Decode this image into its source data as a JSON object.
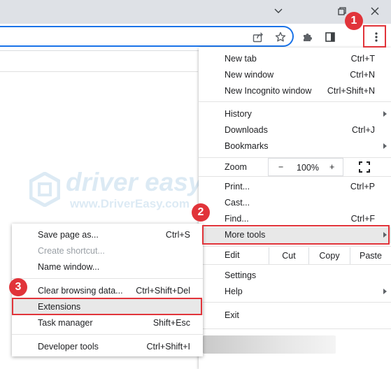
{
  "window": {
    "minimize_icon": "chevron-down-icon",
    "restore_icon": "restore-icon",
    "close_icon": "close-icon"
  },
  "toolbar": {
    "share_icon": "share-icon",
    "bookmark_icon": "star-icon",
    "extensions_icon": "puzzle-icon",
    "side_panel_icon": "side-panel-icon",
    "menu_icon": "kebab-menu-icon"
  },
  "watermark": {
    "name": "driver easy",
    "url": "www.DriverEasy.com"
  },
  "menu": {
    "new_tab": {
      "label": "New tab",
      "shortcut": "Ctrl+T"
    },
    "new_window": {
      "label": "New window",
      "shortcut": "Ctrl+N"
    },
    "new_incognito": {
      "label": "New Incognito window",
      "shortcut": "Ctrl+Shift+N"
    },
    "history": {
      "label": "History"
    },
    "downloads": {
      "label": "Downloads",
      "shortcut": "Ctrl+J"
    },
    "bookmarks": {
      "label": "Bookmarks"
    },
    "zoom": {
      "label": "Zoom",
      "minus": "−",
      "value": "100%",
      "plus": "+"
    },
    "print": {
      "label": "Print...",
      "shortcut": "Ctrl+P"
    },
    "cast": {
      "label": "Cast..."
    },
    "find": {
      "label": "Find...",
      "shortcut": "Ctrl+F"
    },
    "more_tools": {
      "label": "More tools"
    },
    "edit": {
      "label": "Edit",
      "cut": "Cut",
      "copy": "Copy",
      "paste": "Paste"
    },
    "settings": {
      "label": "Settings"
    },
    "help": {
      "label": "Help"
    },
    "exit": {
      "label": "Exit"
    }
  },
  "submenu": {
    "save_page": {
      "label": "Save page as...",
      "shortcut": "Ctrl+S"
    },
    "create_shortcut": {
      "label": "Create shortcut..."
    },
    "name_window": {
      "label": "Name window..."
    },
    "clear_data": {
      "label": "Clear browsing data...",
      "shortcut": "Ctrl+Shift+Del"
    },
    "extensions": {
      "label": "Extensions"
    },
    "task_manager": {
      "label": "Task manager",
      "shortcut": "Shift+Esc"
    },
    "dev_tools": {
      "label": "Developer tools",
      "shortcut": "Ctrl+Shift+I"
    }
  },
  "annotations": {
    "step1": "1",
    "step2": "2",
    "step3": "3",
    "color": "#e1343a"
  }
}
